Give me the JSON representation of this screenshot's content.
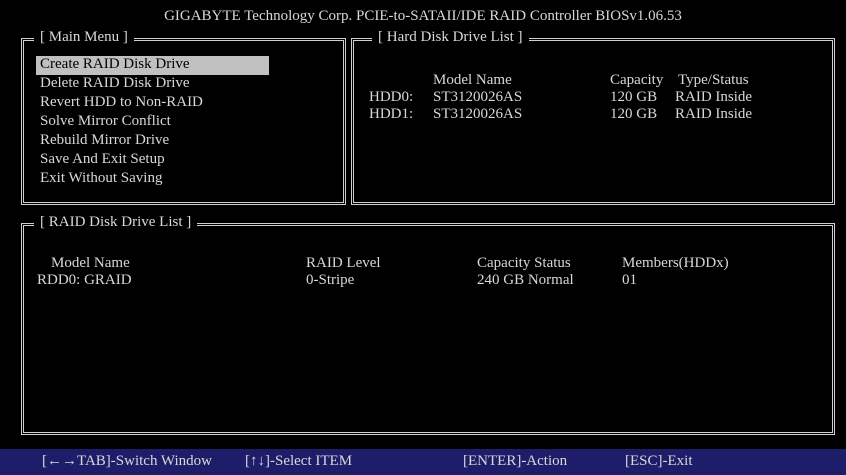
{
  "title": "GIGABYTE Technology Corp. PCIE-to-SATAII/IDE RAID Controller BIOSv1.06.53",
  "main_menu": {
    "label": "[ Main Menu ]",
    "items": [
      "Create RAID Disk Drive",
      "Delete RAID Disk Drive",
      "Revert HDD to Non-RAID",
      "Solve Mirror Conflict",
      "Rebuild Mirror Drive",
      "Save And Exit Setup",
      "Exit Without Saving"
    ],
    "selected_index": 0
  },
  "hdd_list": {
    "label": "[ Hard Disk Drive List ]",
    "columns": [
      "Model Name",
      "Capacity",
      "Type/Status"
    ],
    "rows": [
      {
        "id": "HDD0:",
        "model": "ST3120026AS",
        "capacity": "120 GB",
        "status": "RAID Inside"
      },
      {
        "id": "HDD1:",
        "model": "ST3120026AS",
        "capacity": "120 GB",
        "status": "RAID Inside"
      }
    ]
  },
  "raid_list": {
    "label": "[ RAID Disk Drive List ]",
    "columns": [
      "Model Name",
      "RAID Level",
      "Capacity Status",
      "Members(HDDx)"
    ],
    "rows": [
      {
        "name": "RDD0: GRAID",
        "level": "0-Stripe",
        "capacity_status": "240 GB Normal",
        "members": "01"
      }
    ]
  },
  "footer": {
    "switch": "[←→TAB]-Switch Window",
    "select": "[↑↓]-Select ITEM",
    "action": "[ENTER]-Action",
    "exit": "[ESC]-Exit"
  },
  "colors": {
    "background": "#000000",
    "text": "#d8d8d8",
    "highlight": "#c0c0c0",
    "footer_bar": "#1e1d6a"
  }
}
